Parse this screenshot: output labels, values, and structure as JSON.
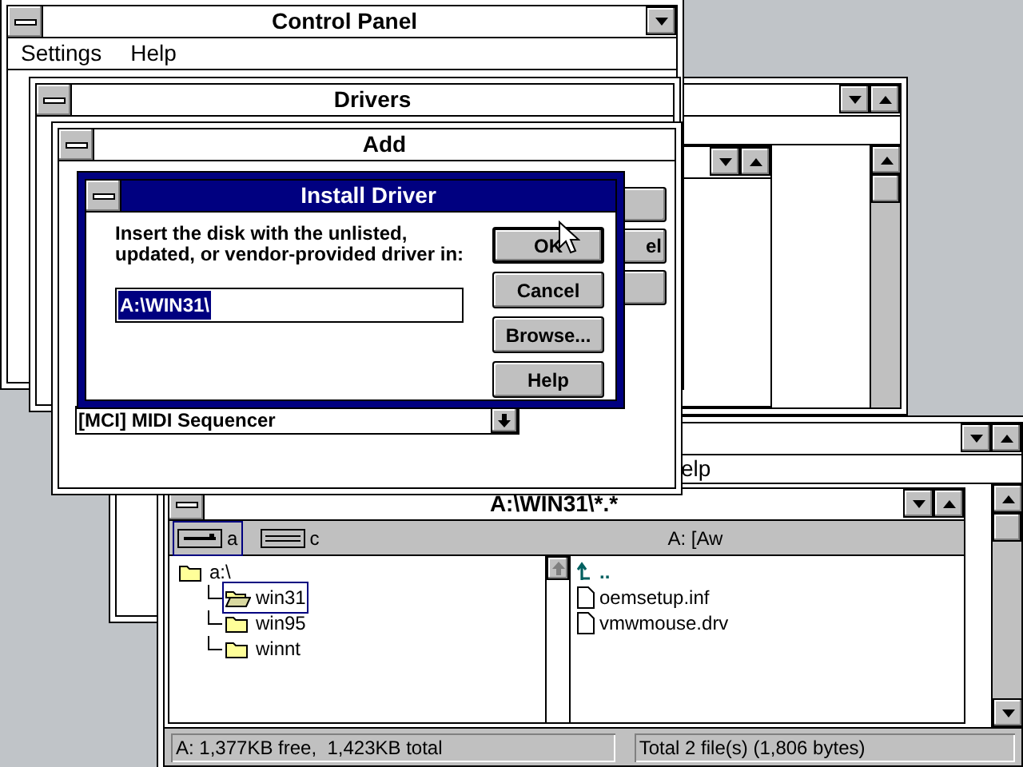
{
  "control_panel": {
    "title": "Control Panel",
    "menu": [
      {
        "label": "Settings"
      },
      {
        "label": "Help"
      }
    ]
  },
  "drivers_window": {
    "title": "Drivers"
  },
  "add_window": {
    "title": "Add",
    "list_item": "[MCI] MIDI Sequencer",
    "button_fragment": "el"
  },
  "install_driver": {
    "title": "Install Driver",
    "prompt": "Insert the disk with the unlisted, updated, or vendor-provided driver in:",
    "path": "A:\\WIN31\\",
    "buttons": [
      {
        "label": "OK",
        "default": true
      },
      {
        "label": "Cancel",
        "default": false
      },
      {
        "label": "Browse...",
        "default": false
      },
      {
        "label": "Help",
        "default": false
      }
    ]
  },
  "file_manager": {
    "menu_fragment": "elp",
    "child_title": "A:\\WIN31\\*.*",
    "drives": [
      {
        "letter": "a",
        "kind": "floppy",
        "selected": true
      },
      {
        "letter": "c",
        "kind": "hard",
        "selected": false
      }
    ],
    "volume": "A: [Aw",
    "tree": [
      {
        "label": "a:\\",
        "selected": false,
        "children": [
          {
            "label": "win31",
            "selected": true
          },
          {
            "label": "win95",
            "selected": false
          },
          {
            "label": "winnt",
            "selected": false
          }
        ]
      }
    ],
    "files": [
      {
        "kind": "up",
        "label": ".."
      },
      {
        "kind": "file",
        "label": "oemsetup.inf"
      },
      {
        "kind": "file",
        "label": "vmwmouse.drv"
      }
    ],
    "status": [
      "A: 1,377KB free,  1,423KB total",
      "Total 2 file(s) (1,806 bytes)"
    ]
  }
}
